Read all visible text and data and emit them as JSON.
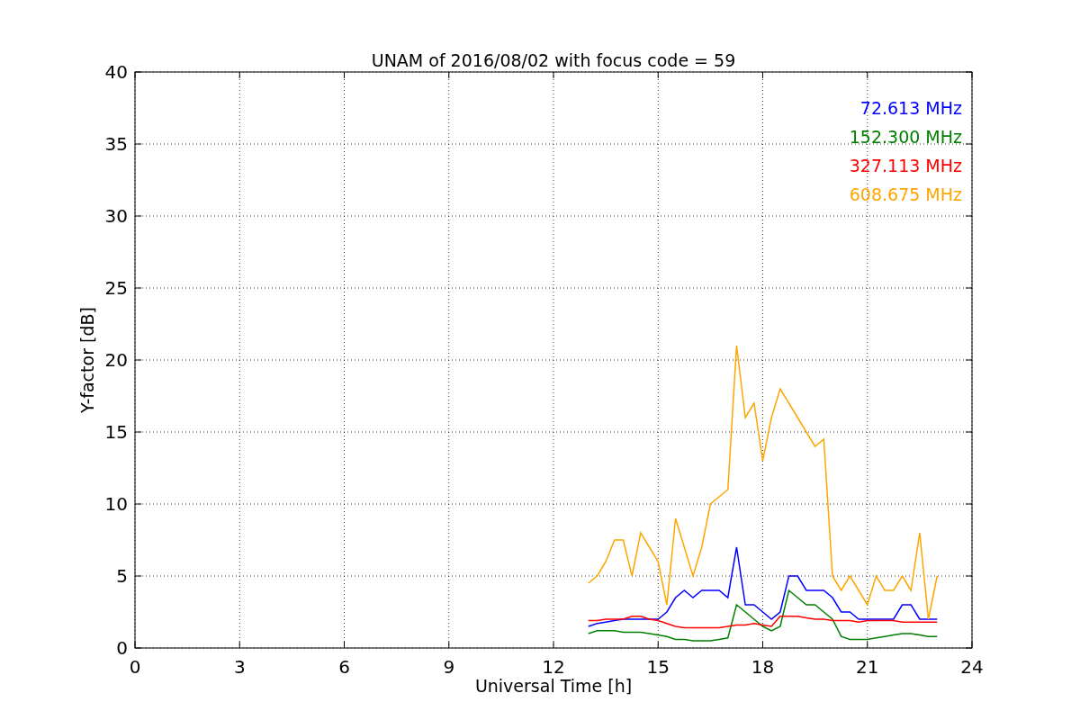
{
  "figure": {
    "chart_data": {
      "type": "line",
      "title": "UNAM of 2016/08/02 with focus code = 59",
      "xlabel": "Universal Time [h]",
      "ylabel": "Y-factor [dB]",
      "x": [
        13,
        13.25,
        13.5,
        13.75,
        14,
        14.25,
        14.5,
        14.75,
        15,
        15.25,
        15.5,
        15.75,
        16,
        16.25,
        16.5,
        16.75,
        17,
        17.25,
        17.5,
        17.75,
        18,
        18.25,
        18.5,
        18.75,
        19,
        19.25,
        19.5,
        19.75,
        20,
        20.25,
        20.5,
        20.75,
        21,
        21.25,
        21.5,
        21.75,
        22,
        22.25,
        22.5,
        22.75,
        23
      ],
      "series": [
        {
          "name": "72.613 MHz",
          "color": "#0000ff",
          "values": [
            1.5,
            1.7,
            1.8,
            1.9,
            2,
            2,
            2,
            2,
            2,
            2.5,
            3.5,
            4,
            3.5,
            4,
            4,
            4,
            3.5,
            7,
            3,
            3,
            2.5,
            2,
            2.5,
            5,
            5,
            4,
            4,
            4,
            3.5,
            2.5,
            2.5,
            2,
            2,
            2,
            2,
            2,
            3,
            3,
            2,
            2,
            2
          ]
        },
        {
          "name": "152.300 MHz",
          "color": "#008000",
          "values": [
            1,
            1.2,
            1.2,
            1.2,
            1.1,
            1.1,
            1.1,
            1,
            0.9,
            0.8,
            0.6,
            0.6,
            0.5,
            0.5,
            0.5,
            0.6,
            0.7,
            3,
            2.5,
            2,
            1.5,
            1.2,
            1.5,
            4,
            3.5,
            3,
            3,
            2.5,
            2,
            0.8,
            0.6,
            0.6,
            0.6,
            0.7,
            0.8,
            0.9,
            1,
            1,
            0.9,
            0.8,
            0.8
          ]
        },
        {
          "name": "327.113 MHz",
          "color": "#ff0000",
          "values": [
            1.9,
            1.9,
            2,
            2,
            2,
            2.2,
            2.2,
            2,
            1.9,
            1.7,
            1.5,
            1.4,
            1.4,
            1.4,
            1.4,
            1.4,
            1.5,
            1.6,
            1.6,
            1.7,
            1.6,
            1.5,
            2.2,
            2.2,
            2.2,
            2.1,
            2,
            2,
            1.9,
            1.9,
            1.9,
            1.8,
            1.9,
            1.9,
            1.9,
            1.9,
            1.8,
            1.8,
            1.8,
            1.8,
            1.8
          ]
        },
        {
          "name": "608.675 MHz",
          "color": "#ffa500",
          "values": [
            4.5,
            5,
            6,
            7.5,
            7.5,
            5,
            8,
            7,
            6,
            3,
            9,
            7,
            5,
            7,
            10,
            10.5,
            11,
            21,
            16,
            17,
            13,
            16,
            18,
            17,
            16,
            15,
            14,
            14.5,
            5,
            4,
            5,
            4,
            3,
            5,
            4,
            4,
            5,
            4,
            8,
            2,
            5
          ]
        }
      ],
      "xlim": [
        0,
        24
      ],
      "ylim": [
        0,
        40
      ],
      "xticks": [
        0,
        3,
        6,
        9,
        12,
        15,
        18,
        21,
        24
      ],
      "yticks": [
        0,
        5,
        10,
        15,
        20,
        25,
        30,
        35,
        40
      ],
      "grid": true
    }
  }
}
